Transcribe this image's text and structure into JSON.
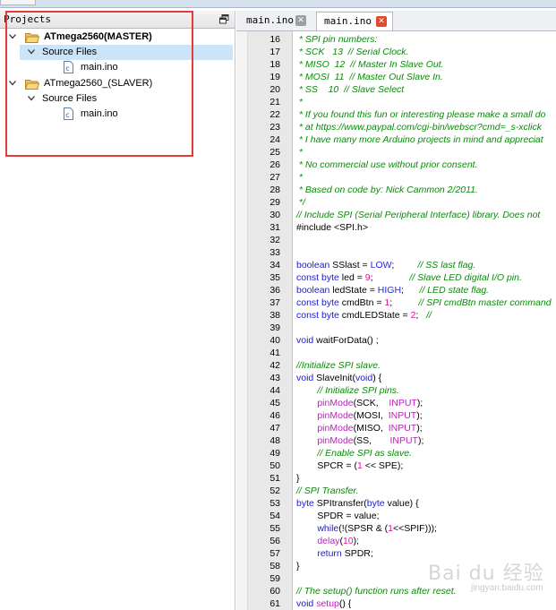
{
  "projects_panel": {
    "title": "Projects",
    "projects": [
      {
        "name": "ATmega2560(MASTER)",
        "folder": "Source Files",
        "file": "main.ino"
      },
      {
        "name": "ATmega2560_(SLAVER)",
        "folder": "Source Files",
        "file": "main.ino"
      }
    ]
  },
  "tabs": [
    {
      "label": "main.ino"
    },
    {
      "label": "main.ino"
    }
  ],
  "code": [
    {
      "n": "16",
      "segs": [
        {
          "t": " * SPI pin numbers:",
          "c": "cm"
        }
      ]
    },
    {
      "n": "17",
      "segs": [
        {
          "t": " * SCK   13  // Serial Clock.",
          "c": "cm"
        }
      ]
    },
    {
      "n": "18",
      "segs": [
        {
          "t": " * MISO  12  // Master In Slave Out.",
          "c": "cm"
        }
      ]
    },
    {
      "n": "19",
      "segs": [
        {
          "t": " * MOSI  11  // Master Out Slave In.",
          "c": "cm"
        }
      ]
    },
    {
      "n": "20",
      "segs": [
        {
          "t": " * SS    10  // Slave Select",
          "c": "cm"
        }
      ]
    },
    {
      "n": "21",
      "segs": [
        {
          "t": " *",
          "c": "cm"
        }
      ]
    },
    {
      "n": "22",
      "segs": [
        {
          "t": " * If you found this fun or interesting please make a small do",
          "c": "cm"
        }
      ]
    },
    {
      "n": "23",
      "segs": [
        {
          "t": " * at https://www.paypal.com/cgi-bin/webscr?cmd=_s-xclick",
          "c": "cm"
        }
      ]
    },
    {
      "n": "24",
      "segs": [
        {
          "t": " * I have many more Arduino projects in mind and appreciat",
          "c": "cm"
        }
      ]
    },
    {
      "n": "25",
      "segs": [
        {
          "t": " *",
          "c": "cm"
        }
      ]
    },
    {
      "n": "26",
      "segs": [
        {
          "t": " * No commercial use without prior consent.",
          "c": "cm"
        }
      ]
    },
    {
      "n": "27",
      "segs": [
        {
          "t": " *",
          "c": "cm"
        }
      ]
    },
    {
      "n": "28",
      "segs": [
        {
          "t": " * Based on code by: Nick Cammon 2/2011.",
          "c": "cm"
        }
      ]
    },
    {
      "n": "29",
      "segs": [
        {
          "t": " */",
          "c": "cm"
        }
      ]
    },
    {
      "n": "30",
      "segs": [
        {
          "t": "// Include SPI (Serial Peripheral Interface) library. Does not",
          "c": "cm"
        }
      ]
    },
    {
      "n": "31",
      "segs": [
        {
          "t": "#include <SPI.h>",
          "c": ""
        }
      ]
    },
    {
      "n": "32",
      "segs": []
    },
    {
      "n": "33",
      "segs": []
    },
    {
      "n": "34",
      "segs": [
        {
          "t": "boolean",
          "c": "kw"
        },
        {
          "t": " SSlast = ",
          "c": ""
        },
        {
          "t": "LOW",
          "c": "cst"
        },
        {
          "t": ";         ",
          "c": ""
        },
        {
          "t": "// SS last flag.",
          "c": "cm"
        }
      ]
    },
    {
      "n": "35",
      "segs": [
        {
          "t": "const",
          "c": "kw"
        },
        {
          "t": " ",
          "c": ""
        },
        {
          "t": "byte",
          "c": "kw"
        },
        {
          "t": " led = ",
          "c": ""
        },
        {
          "t": "9",
          "c": "num"
        },
        {
          "t": ";              ",
          "c": ""
        },
        {
          "t": "// Slave LED digital I/O pin.",
          "c": "cm"
        }
      ]
    },
    {
      "n": "36",
      "segs": [
        {
          "t": "boolean",
          "c": "kw"
        },
        {
          "t": " ledState = ",
          "c": ""
        },
        {
          "t": "HIGH",
          "c": "cst"
        },
        {
          "t": ";      ",
          "c": ""
        },
        {
          "t": "// LED state flag.",
          "c": "cm"
        }
      ]
    },
    {
      "n": "37",
      "segs": [
        {
          "t": "const",
          "c": "kw"
        },
        {
          "t": " ",
          "c": ""
        },
        {
          "t": "byte",
          "c": "kw"
        },
        {
          "t": " cmdBtn = ",
          "c": ""
        },
        {
          "t": "1",
          "c": "num"
        },
        {
          "t": ";          ",
          "c": ""
        },
        {
          "t": "// SPI cmdBtn master command",
          "c": "cm"
        }
      ]
    },
    {
      "n": "38",
      "segs": [
        {
          "t": "const",
          "c": "kw"
        },
        {
          "t": " ",
          "c": ""
        },
        {
          "t": "byte",
          "c": "kw"
        },
        {
          "t": " cmdLEDState = ",
          "c": ""
        },
        {
          "t": "2",
          "c": "num"
        },
        {
          "t": ";   ",
          "c": ""
        },
        {
          "t": "//",
          "c": "cm"
        }
      ]
    },
    {
      "n": "39",
      "segs": []
    },
    {
      "n": "40",
      "segs": [
        {
          "t": "void",
          "c": "kw"
        },
        {
          "t": " waitForData() ;",
          "c": ""
        }
      ]
    },
    {
      "n": "41",
      "segs": []
    },
    {
      "n": "42",
      "segs": [
        {
          "t": "//Initialize SPI slave.",
          "c": "cm"
        }
      ]
    },
    {
      "n": "43",
      "segs": [
        {
          "t": "void",
          "c": "kw"
        },
        {
          "t": " SlaveInit(",
          "c": ""
        },
        {
          "t": "void",
          "c": "kw"
        },
        {
          "t": ") {",
          "c": ""
        }
      ]
    },
    {
      "n": "44",
      "segs": [
        {
          "t": "        ",
          "c": ""
        },
        {
          "t": "// Initialize SPI pins.",
          "c": "cm"
        }
      ]
    },
    {
      "n": "45",
      "segs": [
        {
          "t": "        ",
          "c": ""
        },
        {
          "t": "pinMode",
          "c": "fn"
        },
        {
          "t": "(SCK,    ",
          "c": ""
        },
        {
          "t": "INPUT",
          "c": "inp"
        },
        {
          "t": ");",
          "c": ""
        }
      ]
    },
    {
      "n": "46",
      "segs": [
        {
          "t": "        ",
          "c": ""
        },
        {
          "t": "pinMode",
          "c": "fn"
        },
        {
          "t": "(MOSI,  ",
          "c": ""
        },
        {
          "t": "INPUT",
          "c": "inp"
        },
        {
          "t": ");",
          "c": ""
        }
      ]
    },
    {
      "n": "47",
      "segs": [
        {
          "t": "        ",
          "c": ""
        },
        {
          "t": "pinMode",
          "c": "fn"
        },
        {
          "t": "(MISO,  ",
          "c": ""
        },
        {
          "t": "INPUT",
          "c": "inp"
        },
        {
          "t": ");",
          "c": ""
        }
      ]
    },
    {
      "n": "48",
      "segs": [
        {
          "t": "        ",
          "c": ""
        },
        {
          "t": "pinMode",
          "c": "fn"
        },
        {
          "t": "(SS,       ",
          "c": ""
        },
        {
          "t": "INPUT",
          "c": "inp"
        },
        {
          "t": ");",
          "c": ""
        }
      ]
    },
    {
      "n": "49",
      "segs": [
        {
          "t": "        ",
          "c": ""
        },
        {
          "t": "// Enable SPI as slave.",
          "c": "cm"
        }
      ]
    },
    {
      "n": "50",
      "segs": [
        {
          "t": "        SPCR = (",
          "c": ""
        },
        {
          "t": "1",
          "c": "num"
        },
        {
          "t": " << SPE);",
          "c": ""
        }
      ]
    },
    {
      "n": "51",
      "segs": [
        {
          "t": "}",
          "c": ""
        }
      ]
    },
    {
      "n": "52",
      "segs": [
        {
          "t": "// SPI Transfer.",
          "c": "cm"
        }
      ]
    },
    {
      "n": "53",
      "segs": [
        {
          "t": "byte",
          "c": "kw"
        },
        {
          "t": " SPItransfer(",
          "c": ""
        },
        {
          "t": "byte",
          "c": "kw"
        },
        {
          "t": " value) {",
          "c": ""
        }
      ]
    },
    {
      "n": "54",
      "segs": [
        {
          "t": "        SPDR = value;",
          "c": ""
        }
      ]
    },
    {
      "n": "55",
      "segs": [
        {
          "t": "        ",
          "c": ""
        },
        {
          "t": "while",
          "c": "kw"
        },
        {
          "t": "(!(SPSR & (",
          "c": ""
        },
        {
          "t": "1",
          "c": "num"
        },
        {
          "t": "<<SPIF)));",
          "c": ""
        }
      ]
    },
    {
      "n": "56",
      "segs": [
        {
          "t": "        ",
          "c": ""
        },
        {
          "t": "delay",
          "c": "fn"
        },
        {
          "t": "(",
          "c": ""
        },
        {
          "t": "10",
          "c": "num"
        },
        {
          "t": ");",
          "c": ""
        }
      ]
    },
    {
      "n": "57",
      "segs": [
        {
          "t": "        ",
          "c": ""
        },
        {
          "t": "return",
          "c": "kw"
        },
        {
          "t": " SPDR;",
          "c": ""
        }
      ]
    },
    {
      "n": "58",
      "segs": [
        {
          "t": "}",
          "c": ""
        }
      ]
    },
    {
      "n": "59",
      "segs": []
    },
    {
      "n": "60",
      "segs": [
        {
          "t": "// The setup() function runs after reset.",
          "c": "cm"
        }
      ]
    },
    {
      "n": "61",
      "segs": [
        {
          "t": "void",
          "c": "kw"
        },
        {
          "t": " ",
          "c": ""
        },
        {
          "t": "setup",
          "c": "fn"
        },
        {
          "t": "() {",
          "c": ""
        }
      ]
    }
  ],
  "watermark": {
    "text": "Bai du 经验",
    "sub": "jingyan.baidu.com"
  },
  "colors": {
    "annotation": "#e23b3b",
    "comment": "#0a8a0a",
    "keyword": "#1b1bd1",
    "function": "#c21bc2",
    "number": "#e0129b",
    "selection": "#cce4f7",
    "close_active": "#e04a2a"
  }
}
